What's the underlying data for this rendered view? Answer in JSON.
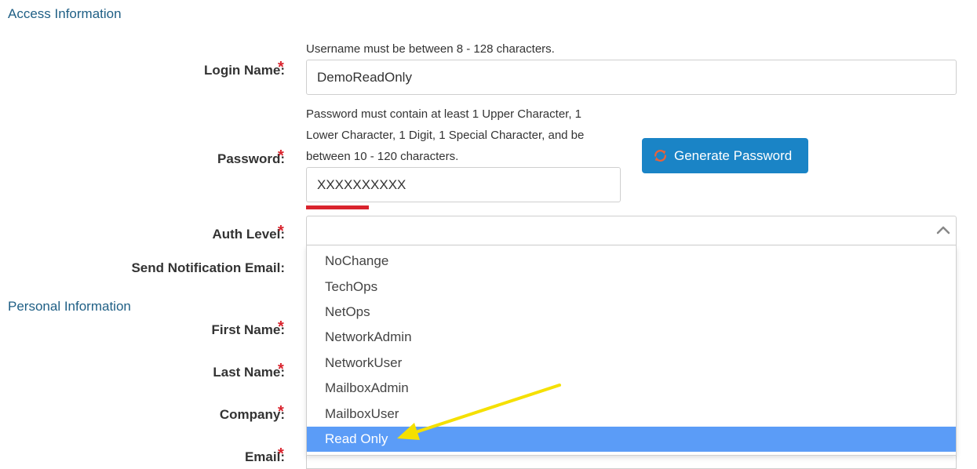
{
  "access_section": {
    "title": "Access Information"
  },
  "login": {
    "label": "Login Name:",
    "hint": "Username must be between 8 - 128 characters.",
    "value": "DemoReadOnly"
  },
  "password": {
    "label": "Password:",
    "hint": "Password must contain at least 1 Upper Character, 1 Lower Character, 1 Digit, 1 Special Character, and be between 10 - 120 characters.",
    "value": "XXXXXXXXXX",
    "generate_label": "Generate Password",
    "strength_color": "#d9232d"
  },
  "auth_level": {
    "label": "Auth Level:",
    "selected_value": "",
    "options": [
      "NoChange",
      "TechOps",
      "NetOps",
      "NetworkAdmin",
      "NetworkUser",
      "MailboxAdmin",
      "MailboxUser",
      "Read Only"
    ],
    "highlighted_option": "Read Only"
  },
  "notification": {
    "label": "Send Notification Email:"
  },
  "personal_section": {
    "title": "Personal Information"
  },
  "personal_fields": {
    "first_name": "First Name:",
    "last_name": "Last Name:",
    "company": "Company:",
    "email": "Email:"
  },
  "required_marker": "*",
  "colors": {
    "section_title": "#1f5f85",
    "required": "#d9232d",
    "primary_button": "#1a84c6",
    "option_highlight": "#5b9cf7",
    "annotation_arrow": "#f5e000"
  },
  "annotation": {
    "arrow_icon": "annotation-arrow-icon"
  }
}
